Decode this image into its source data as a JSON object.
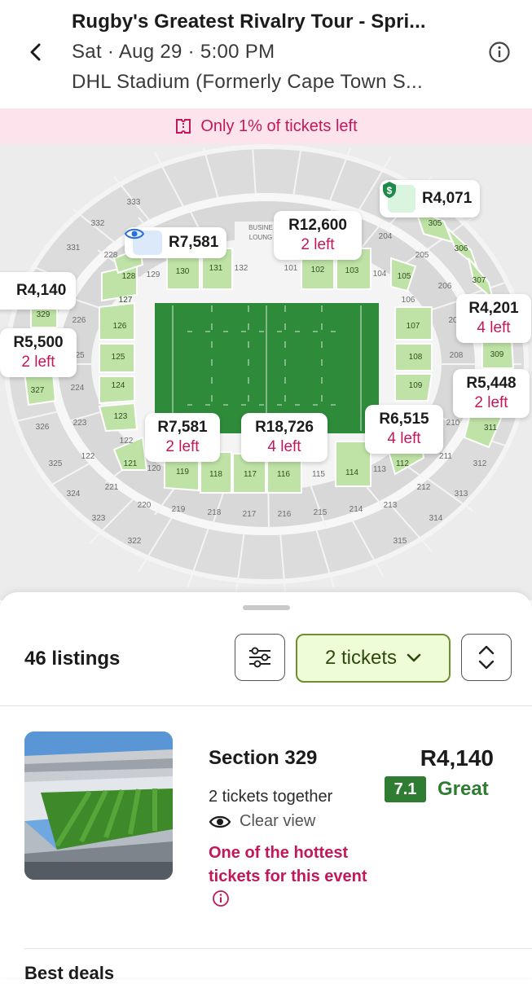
{
  "header": {
    "title": "Rugby's Greatest Rivalry Tour - Spri...",
    "date_line": "Sat · Aug 29 · 5:00 PM",
    "venue_line": "DHL Stadium (Formerly Cape Town S..."
  },
  "banner": {
    "text": "Only 1% of tickets left",
    "color": "#c2185b"
  },
  "map": {
    "pins": [
      {
        "price": "R4,071",
        "left": "",
        "tag": "deal"
      },
      {
        "price": "R12,600",
        "left": "2 left",
        "tag": ""
      },
      {
        "price": "R7,581",
        "left": "",
        "tag": "eye"
      },
      {
        "price": "R4,140",
        "left": "",
        "tag": "hot"
      },
      {
        "price": "R5,500",
        "left": "2 left",
        "tag": ""
      },
      {
        "price": "R4,201",
        "left": "4 left",
        "tag": ""
      },
      {
        "price": "R5,448",
        "left": "2 left",
        "tag": ""
      },
      {
        "price": "R7,581",
        "left": "2 left",
        "tag": ""
      },
      {
        "price": "R18,726",
        "left": "4 left",
        "tag": ""
      },
      {
        "price": "R6,515",
        "left": "4 left",
        "tag": ""
      }
    ],
    "sections": {
      "green": [
        "128",
        "127",
        "126",
        "125",
        "124",
        "123",
        "121",
        "130",
        "131",
        "102",
        "103",
        "105",
        "107",
        "108",
        "109",
        "112",
        "114",
        "116",
        "117",
        "118",
        "119",
        "305",
        "306",
        "307",
        "309",
        "311",
        "329",
        "327"
      ],
      "labels": {
        "s333": "333",
        "s332": "332",
        "s331": "331",
        "s228": "228",
        "s129": "129",
        "s132": "132",
        "s101": "101",
        "s104": "104",
        "s204": "204",
        "s205": "205",
        "s206": "206",
        "s106": "106",
        "s226": "226",
        "s225": "25",
        "s224": "224",
        "s223": "223",
        "s326": "326",
        "s325": "325",
        "s122": "122",
        "s120": "120",
        "s221": "221",
        "s324": "324",
        "s220": "220",
        "s323": "323",
        "s219": "219",
        "s218": "218",
        "s217": "217",
        "s216": "216",
        "s215": "215",
        "s214": "214",
        "s213": "213",
        "s212": "212",
        "s211": "211",
        "s210": "210",
        "s208": "208",
        "s207": "20",
        "s312": "312",
        "s313": "313",
        "s314": "314",
        "s315": "315",
        "s322": "322",
        "s115": "115",
        "s113": "113",
        "business": "BUSINE",
        "lounge": "LOUNG"
      }
    }
  },
  "listings_bar": {
    "count": "46 listings",
    "tickets_label": "2 tickets"
  },
  "listing": {
    "section": "Section 329",
    "price": "R4,140",
    "together": "2 tickets together",
    "view": "Clear view",
    "hot_text": "One of the hottest tickets for this event",
    "score": "7.1",
    "score_word": "Great",
    "score_color": "#2e7d32"
  },
  "footer": {
    "next_heading": "Best deals"
  }
}
